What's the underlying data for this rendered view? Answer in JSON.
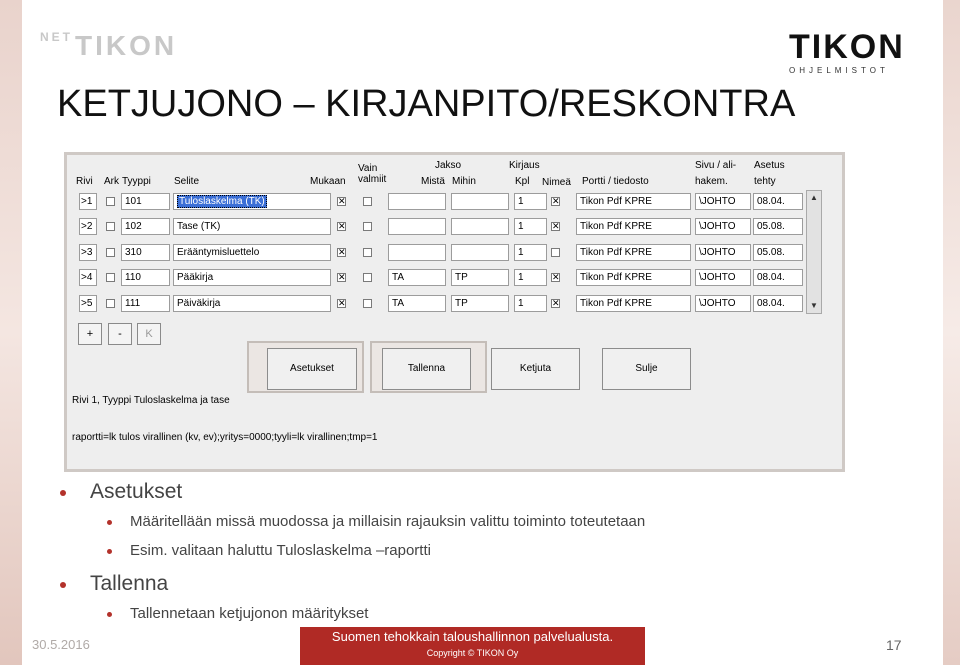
{
  "header": {
    "net_prefix": "NET",
    "net_logo": "TIKON",
    "logo": "TIKON",
    "logo_sub": "OHJELMISTOT",
    "title": "KETJUJONO – KIRJANPITO/RESKONTRA"
  },
  "app": {
    "headers": {
      "vain": "Vain",
      "valmiit": "valmiit",
      "jakso": "Jakso",
      "kirjaus": "Kirjaus",
      "sivu": "Sivu / ali-",
      "hakem": "hakem.",
      "asetus": "Asetus",
      "tehty": "tehty",
      "rivi": "Rivi",
      "ark": "Ark",
      "tyyppi": "Tyyppi",
      "selite": "Selite",
      "mukaan": "Mukaan",
      "mista": "Mistä",
      "mihin": "Mihin",
      "kpl": "Kpl",
      "nimea": "Nimeä",
      "portti": "Portti / tiedosto"
    },
    "rows": [
      {
        "rivi": ">1",
        "tyyppi": "101",
        "selite": "Tuloslaskelma (TK)",
        "mukaan": "✕",
        "mista": "",
        "mihin": "",
        "kpl": "1",
        "nimea": "✕",
        "portti": "Tikon Pdf KPRE",
        "hakem": "\\JOHTO",
        "tehty": "08.04."
      },
      {
        "rivi": ">2",
        "tyyppi": "102",
        "selite": "Tase (TK)",
        "mukaan": "✕",
        "mista": "",
        "mihin": "",
        "kpl": "1",
        "nimea": "✕",
        "portti": "Tikon Pdf KPRE",
        "hakem": "\\JOHTO",
        "tehty": "05.08."
      },
      {
        "rivi": ">3",
        "tyyppi": "310",
        "selite": "Erääntymisluettelo",
        "mukaan": "✕",
        "mista": "",
        "mihin": "",
        "kpl": "1",
        "nimea": "",
        "portti": "Tikon Pdf KPRE",
        "hakem": "\\JOHTO",
        "tehty": "05.08."
      },
      {
        "rivi": ">4",
        "tyyppi": "110",
        "selite": "Pääkirja",
        "mukaan": "✕",
        "mista": "TA",
        "mihin": "TP",
        "kpl": "1",
        "nimea": "✕",
        "portti": "Tikon Pdf KPRE",
        "hakem": "\\JOHTO",
        "tehty": "08.04."
      },
      {
        "rivi": ">5",
        "tyyppi": "111",
        "selite": "Päiväkirja",
        "mukaan": "✕",
        "mista": "TA",
        "mihin": "TP",
        "kpl": "1",
        "nimea": "✕",
        "portti": "Tikon Pdf KPRE",
        "hakem": "\\JOHTO",
        "tehty": "08.04."
      }
    ],
    "small_buttons": [
      "+",
      "-",
      "K"
    ],
    "buttons": {
      "asetukset": "Asetukset",
      "tallenna": "Tallenna",
      "ketjuta": "Ketjuta",
      "sulje": "Sulje"
    },
    "status_line1": "Rivi 1, Tyyppi Tuloslaskelma ja tase",
    "status_line2": "raportti=lk tulos virallinen (kv, ev);yritys=0000;tyyli=lk virallinen;tmp=1"
  },
  "bullets": {
    "b1": "Asetukset",
    "b1_1": "Määritellään missä muodossa ja millaisin rajauksin valittu toiminto toteutetaan",
    "b1_2": "Esim. valitaan haluttu Tuloslaskelma –raportti",
    "b2": "Tallenna",
    "b2_1": "Tallennetaan ketjujonon määritykset"
  },
  "footer": {
    "date": "30.5.2016",
    "line1": "Suomen tehokkain taloushallinnon palvelualusta.",
    "line2": "Copyright © TIKON Oy",
    "page": "17"
  },
  "colors": {
    "accent": "#b02a25",
    "selection": "#3b6fd6"
  }
}
